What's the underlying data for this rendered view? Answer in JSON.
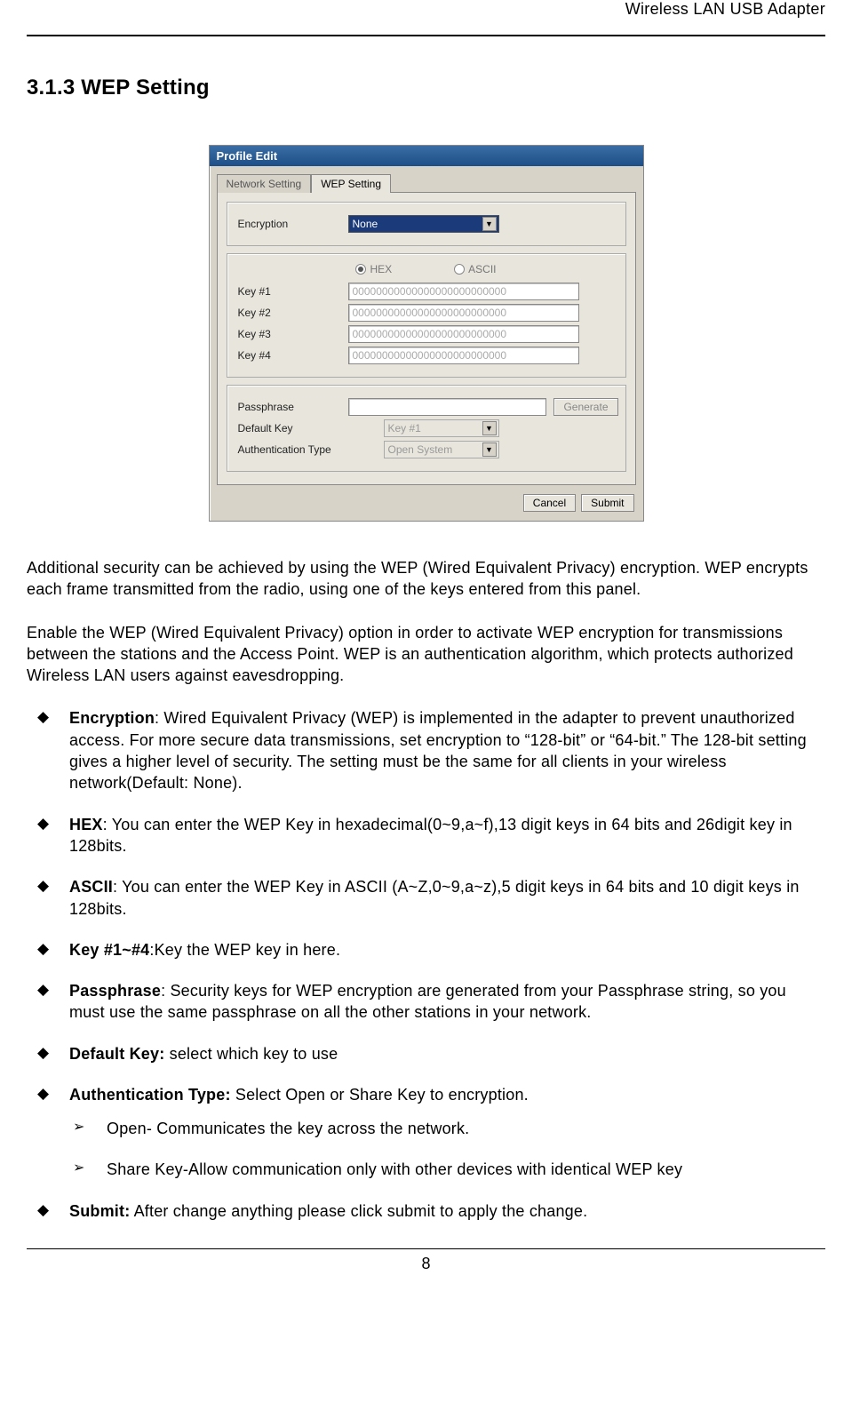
{
  "header": {
    "doc_title": "Wireless LAN USB Adapter"
  },
  "section": {
    "heading": "3.1.3 WEP Setting"
  },
  "dialog": {
    "title": "Profile Edit",
    "tabs": {
      "network": "Network Setting",
      "wep": "WEP Setting"
    },
    "encryption": {
      "label": "Encryption",
      "value": "None"
    },
    "radio": {
      "hex": "HEX",
      "ascii": "ASCII"
    },
    "keys": {
      "k1_label": "Key #1",
      "k1_val": "00000000000000000000000000",
      "k2_label": "Key #2",
      "k2_val": "00000000000000000000000000",
      "k3_label": "Key #3",
      "k3_val": "00000000000000000000000000",
      "k4_label": "Key #4",
      "k4_val": "00000000000000000000000000"
    },
    "passphrase": {
      "label": "Passphrase",
      "value": "",
      "button": "Generate"
    },
    "default_key": {
      "label": "Default Key",
      "value": "Key #1"
    },
    "auth_type": {
      "label": "Authentication Type",
      "value": "Open System"
    },
    "buttons": {
      "cancel": "Cancel",
      "submit": "Submit"
    }
  },
  "paras": {
    "p1": "Additional security can be achieved by using the WEP (Wired Equivalent Privacy) encryption. WEP encrypts each frame transmitted from the radio, using one of the keys entered from this panel.",
    "p2": "Enable the WEP (Wired Equivalent Privacy) option in order to activate WEP encryption for transmissions between the stations and the Access Point. WEP is an authentication algorithm, which protects authorized Wireless LAN users against eavesdropping."
  },
  "bullets": {
    "encryption": {
      "title": "Encryption",
      "text": ": Wired Equivalent Privacy (WEP) is implemented in the adapter to prevent unauthorized access. For more secure data transmissions, set encryption to “128-bit” or “64-bit.” The 128-bit setting gives a higher level of security. The setting must be the same for all clients in your wireless network(Default: None)."
    },
    "hex": {
      "title": "HEX",
      "text": ": You can enter the WEP Key in hexadecimal(0~9,a~f),13 digit keys in 64 bits and 26digit key in 128bits."
    },
    "ascii": {
      "title": "ASCII",
      "text": ": You can enter the WEP Key in ASCII (A~Z,0~9,a~z),5 digit keys in 64 bits and 10 digit keys in 128bits."
    },
    "keys": {
      "title": "Key #1~#4",
      "text": ":Key the WEP key in here."
    },
    "passphrase": {
      "title": "Passphrase",
      "text": ": Security keys for WEP encryption are generated from your Passphrase string, so you must use the same passphrase on all the other stations in your network."
    },
    "default_key": {
      "title": "Default Key:",
      "text": " select which key to use"
    },
    "auth": {
      "title": "Authentication Type:",
      "text": " Select Open or Share Key to encryption.",
      "sub1": "Open- Communicates the key across the network.",
      "sub2": "Share Key-Allow communication only with other devices with identical WEP key"
    },
    "submit": {
      "title": "Submit:",
      "text": " After change anything please click submit to apply the change."
    }
  },
  "page_number": "8"
}
